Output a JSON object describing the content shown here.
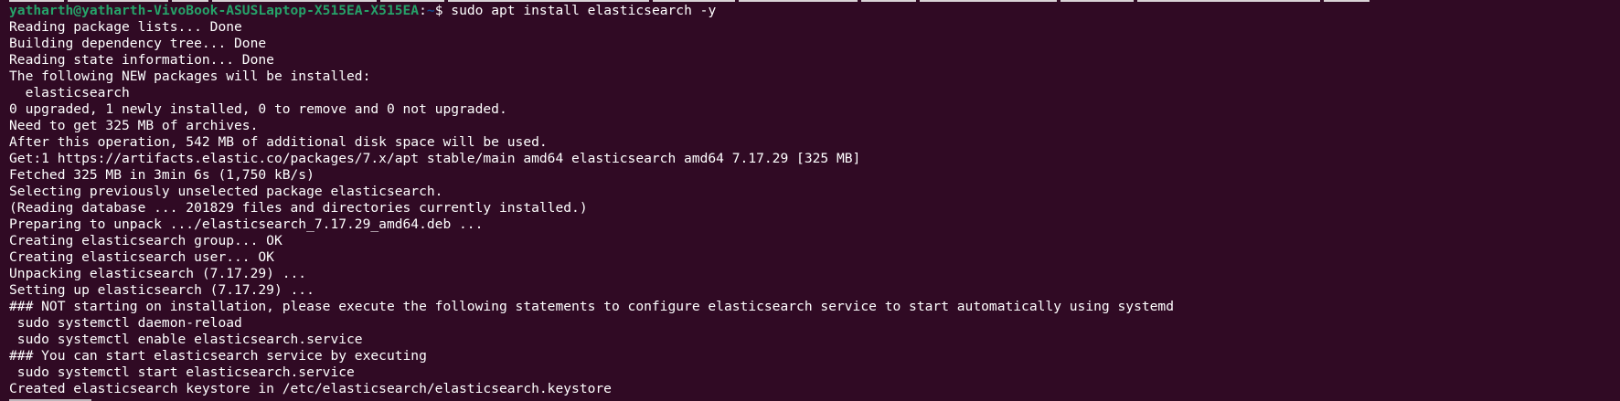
{
  "terminal": {
    "prompt": {
      "user_host": "yatharth@yatharth-VivoBook-ASUSLaptop-X515EA-X515EA",
      "separator": ":",
      "path": "~",
      "symbol": "$",
      "command": " sudo apt install elasticsearch -y"
    },
    "output": [
      "Reading package lists... Done",
      "Building dependency tree... Done",
      "Reading state information... Done",
      "The following NEW packages will be installed:",
      "  elasticsearch",
      "0 upgraded, 1 newly installed, 0 to remove and 0 not upgraded.",
      "Need to get 325 MB of archives.",
      "After this operation, 542 MB of additional disk space will be used.",
      "Get:1 https://artifacts.elastic.co/packages/7.x/apt stable/main amd64 elasticsearch amd64 7.17.29 [325 MB]",
      "Fetched 325 MB in 3min 6s (1,750 kB/s)",
      "Selecting previously unselected package elasticsearch.",
      "(Reading database ... 201829 files and directories currently installed.)",
      "Preparing to unpack .../elasticsearch_7.17.29_amd64.deb ...",
      "Creating elasticsearch group... OK",
      "Creating elasticsearch user... OK",
      "Unpacking elasticsearch (7.17.29) ...",
      "Setting up elasticsearch (7.17.29) ...",
      "### NOT starting on installation, please execute the following statements to configure elasticsearch service to start automatically using systemd",
      " sudo systemctl daemon-reload",
      " sudo systemctl enable elasticsearch.service",
      "### You can start elasticsearch service by executing",
      " sudo systemctl start elasticsearch.service",
      "Created elasticsearch keystore in /etc/elasticsearch/elasticsearch.keystore"
    ]
  }
}
